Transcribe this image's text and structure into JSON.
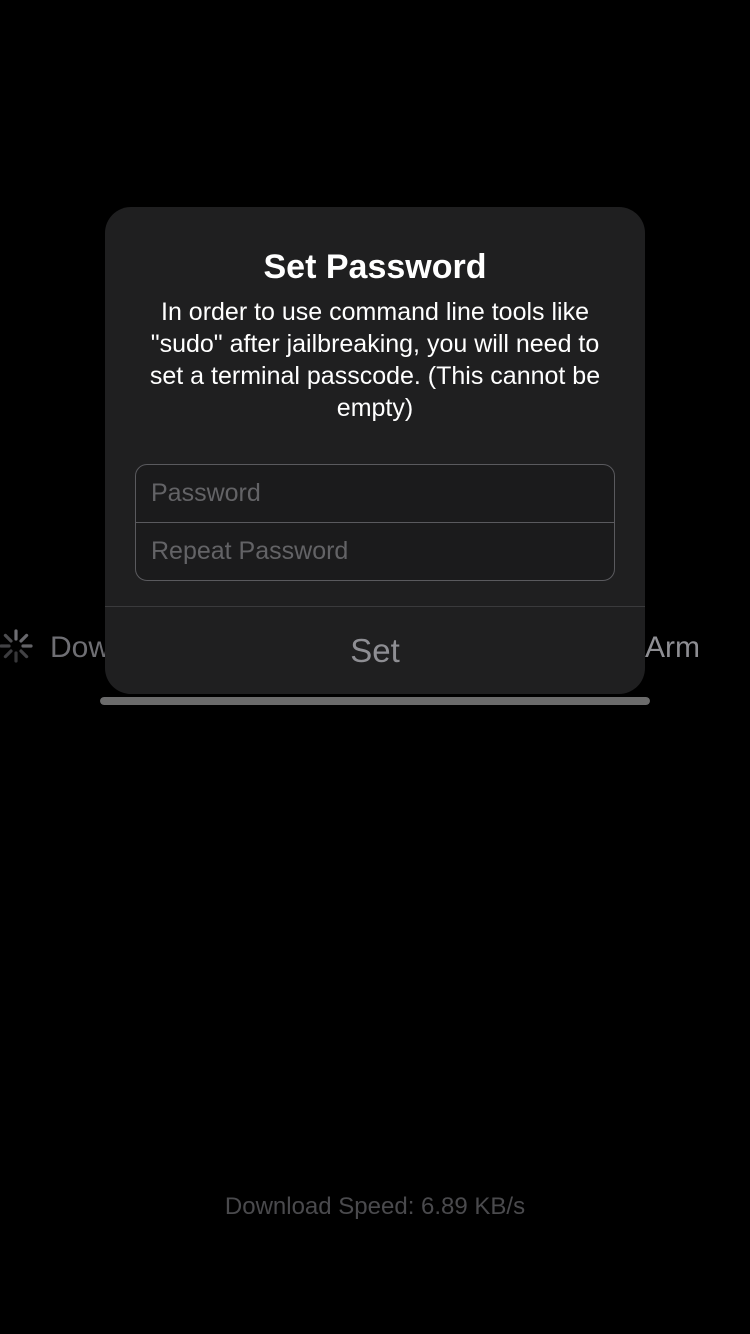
{
  "background": {
    "status_left": "Dow",
    "status_right": "Arm",
    "progress_fraction": 1.0,
    "download_speed": "Download Speed: 6.89 KB/s"
  },
  "alert": {
    "title": "Set Password",
    "message": "In order to use command line tools like \"sudo\" after jailbreaking, you will need to set a terminal passcode. (This cannot be empty)",
    "password_placeholder": "Password",
    "repeat_password_placeholder": "Repeat Password",
    "set_label": "Set"
  },
  "colors": {
    "background": "#000000",
    "alert_bg": "#1f1f20",
    "disabled_button": "#8e8e93"
  },
  "icons": {
    "spinner": "activity-spinner-icon"
  }
}
